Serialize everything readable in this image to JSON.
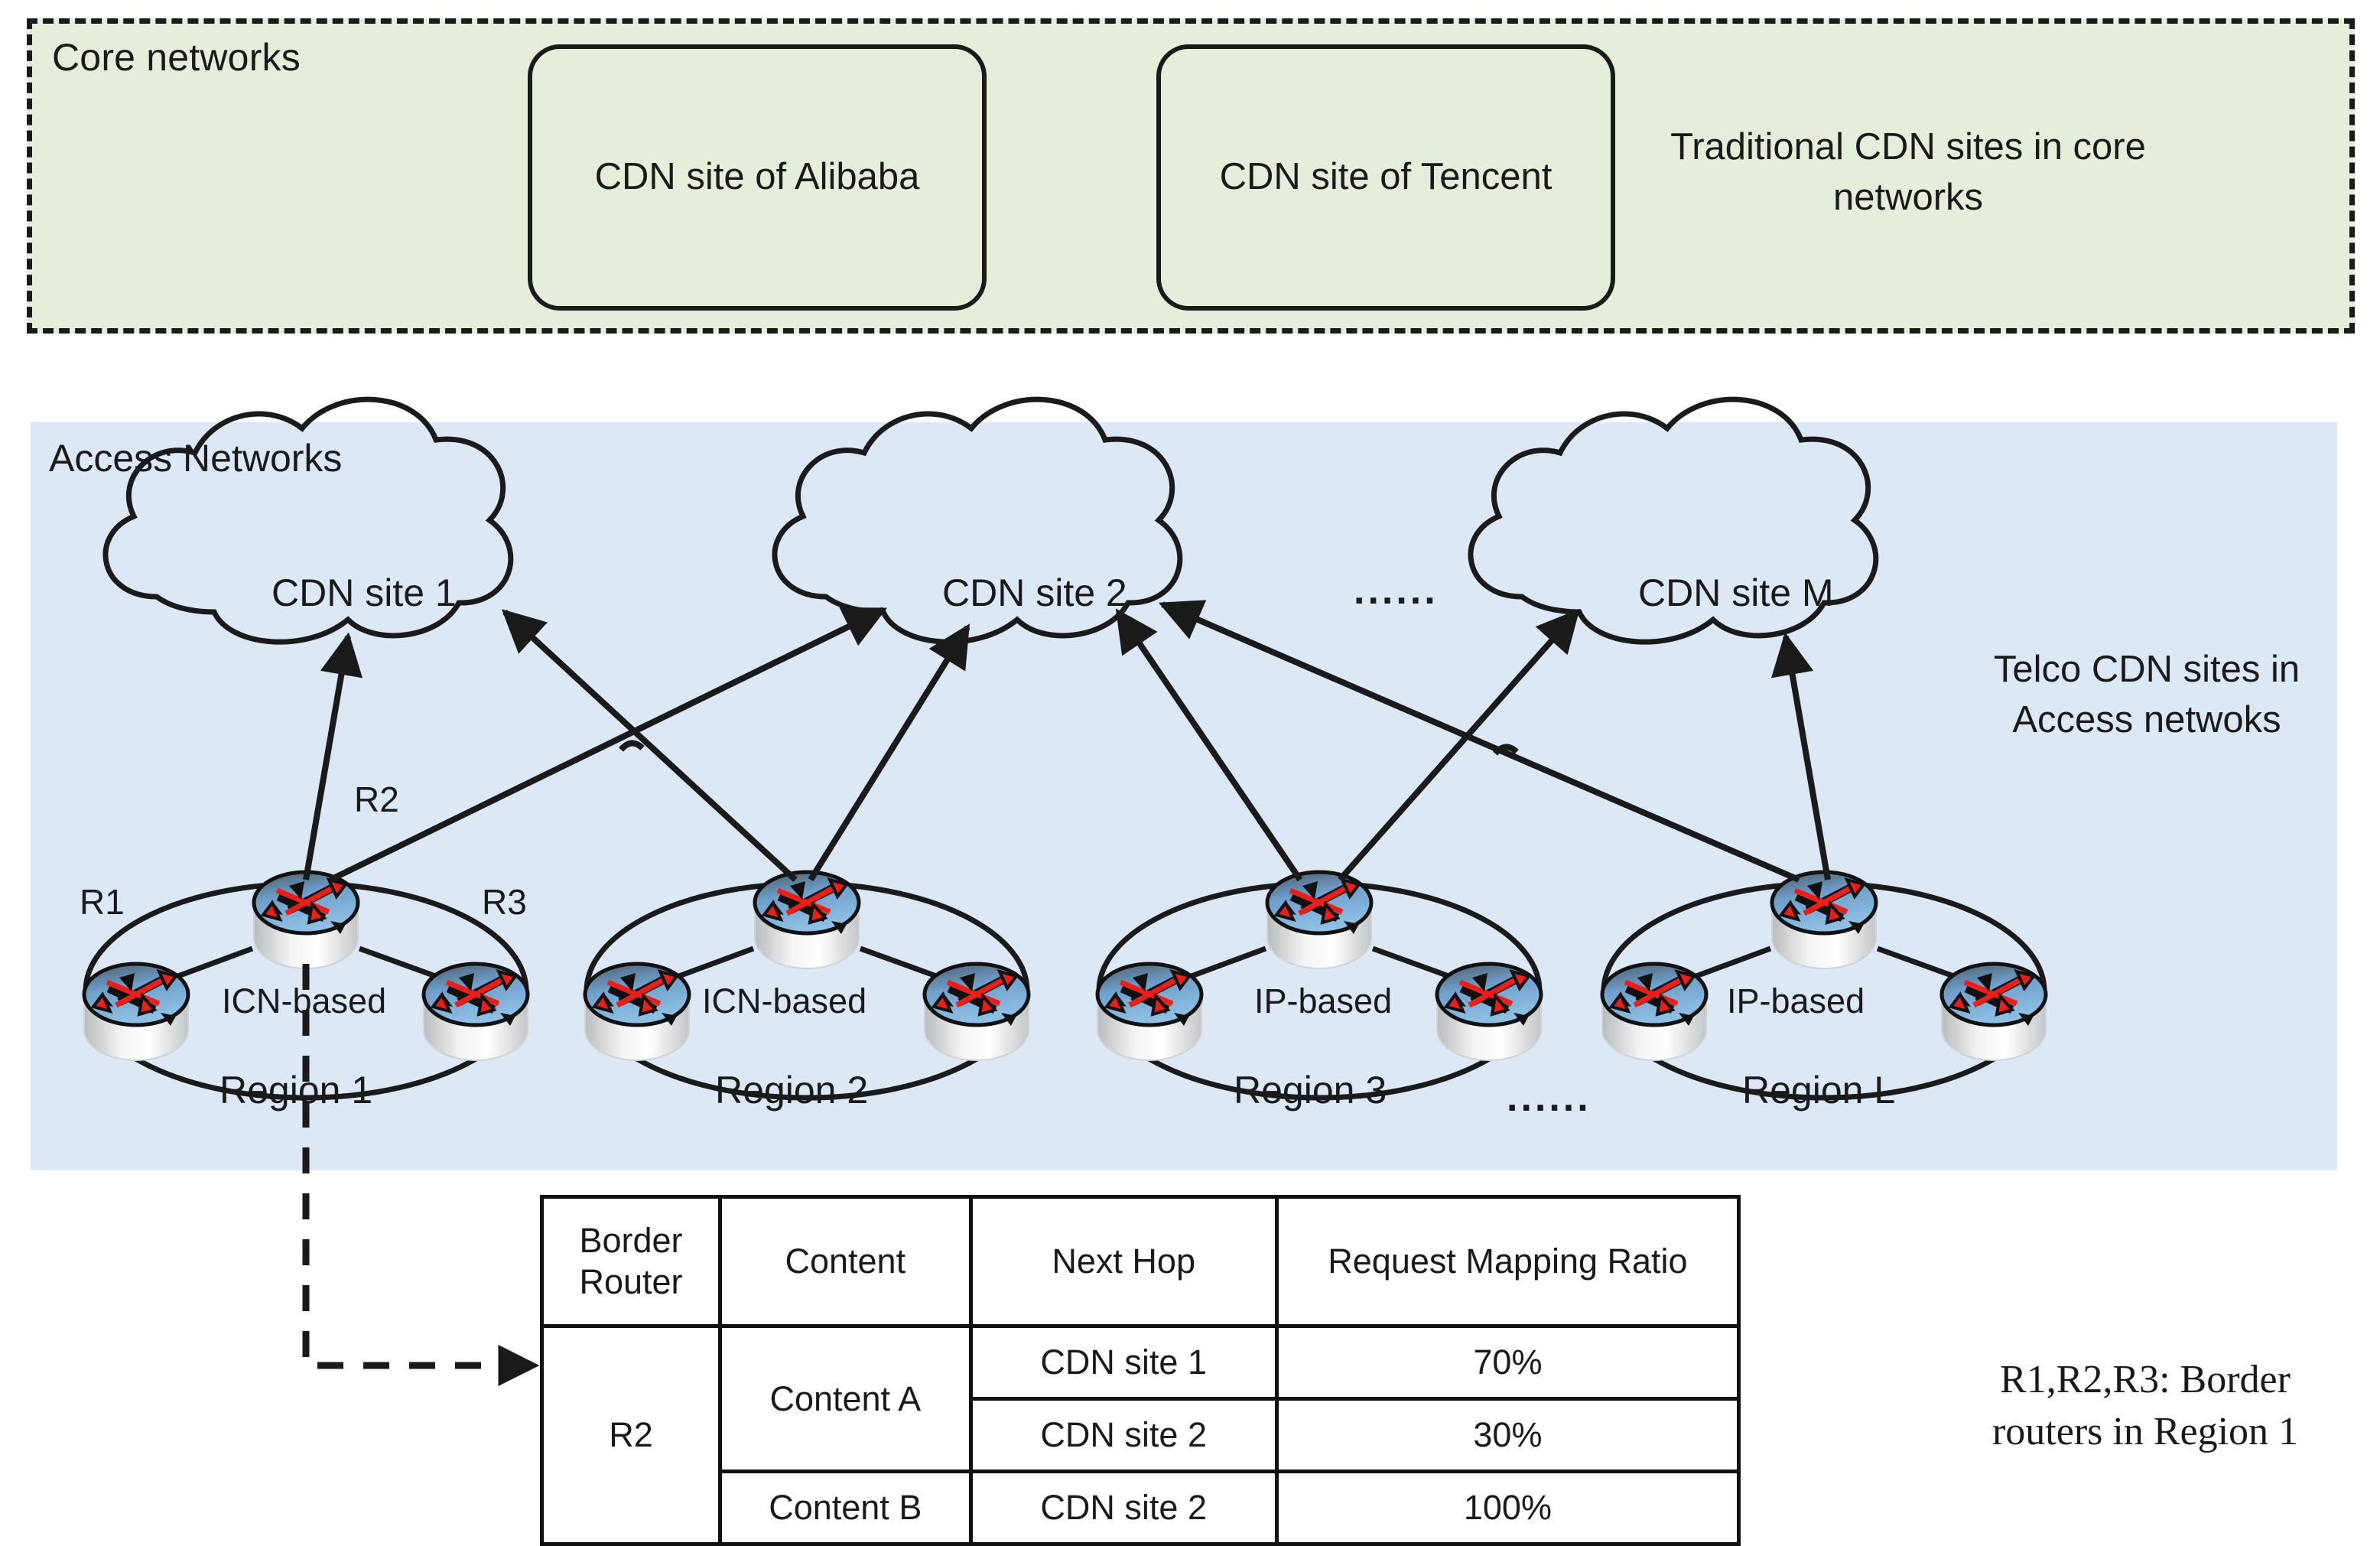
{
  "core_networks": {
    "label": "Core networks",
    "sites": [
      {
        "name": "core-site-alibaba",
        "label": "CDN site of Alibaba"
      },
      {
        "name": "core-site-tencent",
        "label": "CDN site of Tencent"
      }
    ],
    "note": "Traditional CDN sites in core networks",
    "background_color": "#e4eeda",
    "border_style": "dashed"
  },
  "access_networks": {
    "label": "Access Networks",
    "note": "Telco CDN sites in Access netwoks",
    "background_color": "#dce8f5",
    "clouds": [
      {
        "name": "cdn-site-1",
        "label": "CDN site 1"
      },
      {
        "name": "cdn-site-2",
        "label": "CDN site 2"
      },
      {
        "name": "cdn-site-m",
        "label": "CDN site M"
      }
    ],
    "cloud_ellipsis": "......",
    "region_ellipsis": "......",
    "regions": [
      {
        "name": "region-1",
        "label": "Region 1",
        "technology": "ICN-based",
        "routers": [
          "R1",
          "R2",
          "R3"
        ]
      },
      {
        "name": "region-2",
        "label": "Region 2",
        "technology": "ICN-based",
        "routers": [
          "",
          "",
          ""
        ]
      },
      {
        "name": "region-3",
        "label": "Region 3",
        "technology": "IP-based",
        "routers": [
          "",
          "",
          ""
        ]
      },
      {
        "name": "region-l",
        "label": "Region L",
        "technology": "IP-based",
        "routers": [
          "",
          "",
          ""
        ]
      }
    ],
    "router_labels": {
      "r1": "R1",
      "r2": "R2",
      "r3": "R3"
    }
  },
  "mapping_table": {
    "headers": [
      "Border Router",
      "Content",
      "Next Hop",
      "Request Mapping Ratio"
    ],
    "header_border_router_line1": "Border",
    "header_border_router_line2": "Router",
    "header_content": "Content",
    "header_next_hop": "Next Hop",
    "header_ratio": "Request Mapping Ratio",
    "border_router": "R2",
    "rows": [
      {
        "content": "Content A",
        "next_hop": "CDN site 1",
        "ratio": "70%"
      },
      {
        "content": "Content A",
        "next_hop": "CDN site 2",
        "ratio": "30%"
      },
      {
        "content": "Content B",
        "next_hop": "CDN site 2",
        "ratio": "100%"
      }
    ]
  },
  "legend": {
    "text": "R1,R2,R3: Border routers in Region 1"
  },
  "colors": {
    "core_fill": "#e4eeda",
    "access_fill": "#dce8f5",
    "line": "#1a1a1a",
    "router_top": "#6f9fcb",
    "router_arrow": "#e8201c",
    "table_border": "#111111"
  }
}
